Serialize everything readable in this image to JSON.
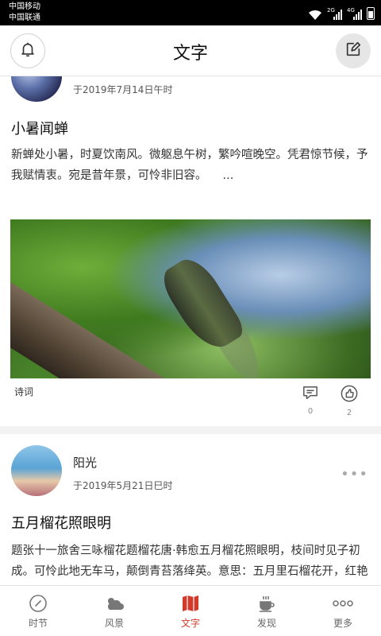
{
  "status_bar": {
    "carrier_1": "中国移动",
    "carrier_2": "中国联通",
    "network_1": "2G",
    "network_2": "4G"
  },
  "header": {
    "title": "文字",
    "left_icon": "bell-icon",
    "right_icon": "edit-icon"
  },
  "posts": [
    {
      "author": "",
      "date": "于2019年7月14日午时",
      "title": "小暑闻蝉",
      "body": "新蝉处小暑，时夏饮南风。微躯息午树，繁吟喧晚空。凭君惊节候，予我赋情衷。宛是昔年景，可怜非旧容。",
      "ellipsis": "...",
      "tag": "诗词",
      "comments": "0",
      "likes": "2"
    },
    {
      "author": "阳光",
      "date": "于2019年5月21日巳时",
      "title": "五月榴花照眼明",
      "body": "题张十一旅舍三咏榴花题榴花唐·韩愈五月榴花照眼明，枝间时见子初成。可怜此地无车马，颠倒青苔落绛英。意思：五月里石榴花开，红艳似火，耀眼夺目，枝间时可见榴子，于枝子间，可"
    }
  ],
  "tabs": [
    {
      "label": "时节",
      "icon": "compass-icon"
    },
    {
      "label": "风景",
      "icon": "weather-icon"
    },
    {
      "label": "文字",
      "icon": "map-icon",
      "active": true
    },
    {
      "label": "发现",
      "icon": "coffee-icon"
    },
    {
      "label": "更多",
      "icon": "more-icon"
    }
  ],
  "colors": {
    "accent": "#d33a2c",
    "status_bar": "#000000",
    "divider": "#e4e4e4"
  }
}
